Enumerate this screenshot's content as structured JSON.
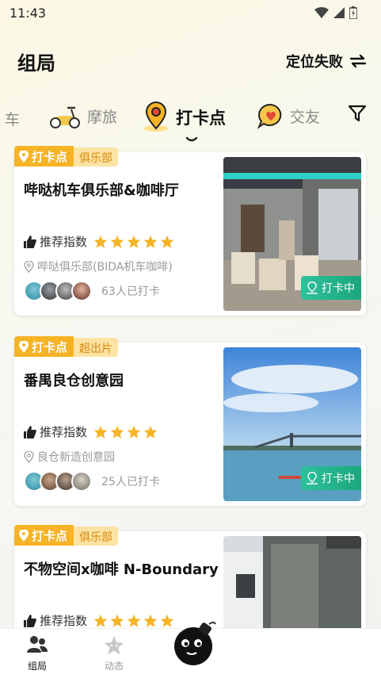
{
  "status_bar": {
    "time": "11:43"
  },
  "header": {
    "title": "组局",
    "location_label": "定位失败"
  },
  "tabs": [
    {
      "label": "车",
      "active": false
    },
    {
      "label": "摩旅",
      "active": false
    },
    {
      "label": "打卡点",
      "active": true
    },
    {
      "label": "交友",
      "active": false
    }
  ],
  "cards": [
    {
      "badge": "打卡点",
      "tag": "俱乐部",
      "name": "哔哒机车俱乐部&咖啡厅",
      "rec_label": "推荐指数",
      "stars": 5,
      "address": "哔哒俱乐部(BIDA机车咖啡)",
      "visit_count": "63人已打卡",
      "status": "打卡中"
    },
    {
      "badge": "打卡点",
      "tag": "超出片",
      "name": "番禺良仓创意园",
      "rec_label": "推荐指数",
      "stars": 4,
      "address": "良仓新造创意园",
      "visit_count": "25人已打卡",
      "status": "打卡中"
    },
    {
      "badge": "打卡点",
      "tag": "俱乐部",
      "name": "不物空间x咖啡 N-Boundary",
      "rec_label": "推荐指数",
      "stars": 5
    }
  ],
  "bottom_nav": [
    {
      "label": "组局",
      "active": true
    },
    {
      "label": "动态",
      "active": false
    }
  ],
  "colors": {
    "accent": "#f6b325",
    "checkin": "#1aa77e",
    "star": "#f6b325"
  }
}
